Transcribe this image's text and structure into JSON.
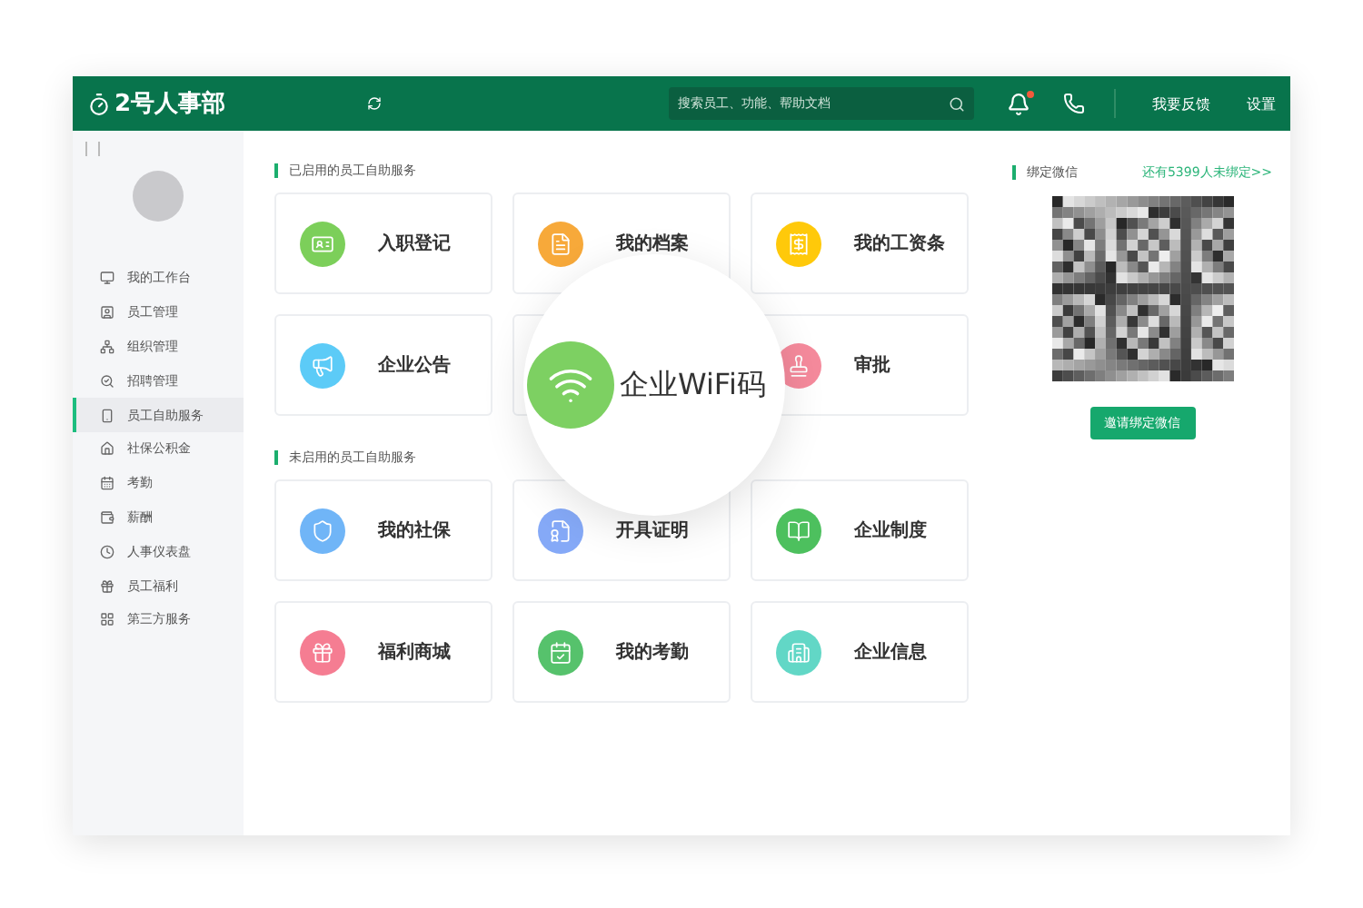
{
  "header": {
    "logo": "2号人事部",
    "search": {
      "placeholder": "搜索员工、功能、帮助文档"
    },
    "notifications": {
      "unread": true
    },
    "links": [
      "我要反馈",
      "设置"
    ]
  },
  "sidebar": {
    "items": [
      {
        "label": "我的工作台",
        "selected": false
      },
      {
        "label": "员工管理",
        "selected": false
      },
      {
        "label": "组织管理",
        "selected": false
      },
      {
        "label": "招聘管理",
        "selected": false
      },
      {
        "label": "员工自助服务",
        "selected": true
      },
      {
        "label": "社保公积金",
        "selected": false
      },
      {
        "label": "考勤",
        "selected": false
      },
      {
        "label": "薪酬",
        "selected": false
      },
      {
        "label": "人事仪表盘",
        "selected": false
      },
      {
        "label": "员工福利",
        "selected": false
      },
      {
        "label": "第三方服务",
        "selected": false
      }
    ]
  },
  "sections": [
    {
      "title": "已启用的员工自助服务",
      "services": [
        {
          "kind": "card",
          "label": "入职登记",
          "color": "#7ccf5a"
        },
        {
          "kind": "card",
          "label": "我的档案",
          "color": "#f7a93a"
        },
        {
          "kind": "card",
          "label": "我的工资条",
          "color": "#ffc90a"
        },
        {
          "kind": "card",
          "label": "企业公告",
          "color": "#5ccbf7"
        },
        {
          "kind": "spotlight",
          "label": "企业WiFi码",
          "color": "#7dd062"
        },
        {
          "kind": "card",
          "label": "审批",
          "color": "#f58a9c"
        }
      ]
    },
    {
      "title": "未启用的员工自助服务",
      "services": [
        {
          "kind": "card",
          "label": "我的社保",
          "color": "#70b5f7"
        },
        {
          "kind": "card",
          "label": "开具证明",
          "color": "#85a9f7"
        },
        {
          "kind": "card",
          "label": "企业制度",
          "color": "#4dc05e"
        },
        {
          "kind": "card",
          "label": "福利商城",
          "color": "#f57d92"
        },
        {
          "kind": "card",
          "label": "我的考勤",
          "color": "#56c26c"
        },
        {
          "kind": "card",
          "label": "企业信息",
          "color": "#62d7c6"
        }
      ]
    }
  ],
  "wechat": {
    "title": "绑定微信",
    "link": "还有5399人未绑定>>",
    "button": "邀请绑定微信"
  }
}
